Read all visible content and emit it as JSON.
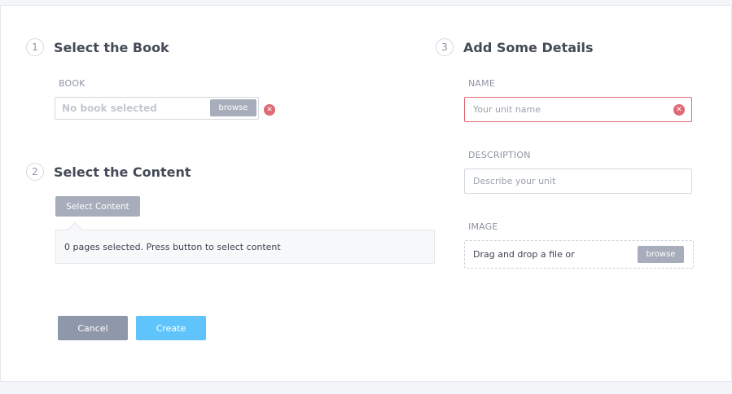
{
  "steps": [
    {
      "number": "1",
      "title": "Select the Book"
    },
    {
      "number": "2",
      "title": "Select the Content"
    },
    {
      "number": "3",
      "title": "Add Some Details"
    }
  ],
  "book": {
    "label": "BOOK",
    "value": "No book selected",
    "browse_label": "browse",
    "error_icon": "close-icon"
  },
  "content": {
    "select_button_label": "Select Content",
    "status_text": "0 pages selected. Press button to select content"
  },
  "details": {
    "name_label": "NAME",
    "name_placeholder": "Your unit name",
    "description_label": "DESCRIPTION",
    "description_placeholder": "Describe your unit",
    "image_label": "IMAGE",
    "image_drop_text": "Drag and drop a file or",
    "image_browse_label": "browse"
  },
  "actions": {
    "cancel_label": "Cancel",
    "create_label": "Create"
  },
  "colors": {
    "error": "#e06a73",
    "create_button": "#5ec4fb",
    "cancel_button": "#8f97ab",
    "secondary_button": "#a7adbb"
  }
}
